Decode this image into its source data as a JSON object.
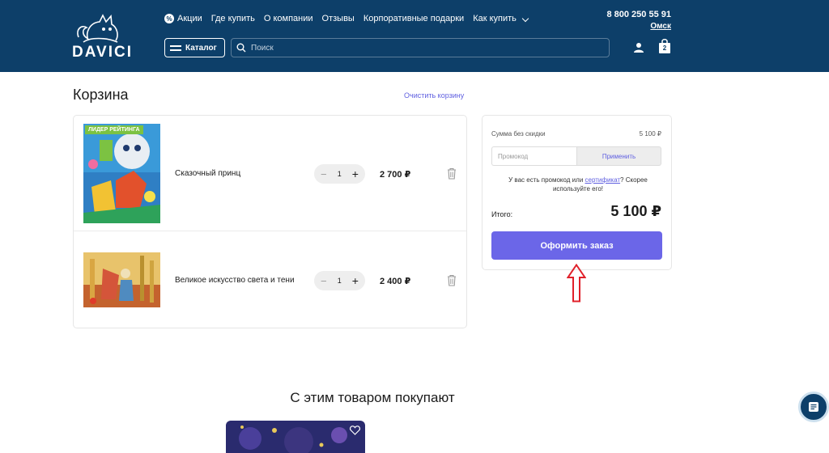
{
  "header": {
    "logo_text": "DAVICI",
    "nav": [
      {
        "label": "Акции"
      },
      {
        "label": "Где купить"
      },
      {
        "label": "О компании"
      },
      {
        "label": "Отзывы"
      },
      {
        "label": "Корпоративные подарки"
      },
      {
        "label": "Как купить"
      }
    ],
    "phone": "8 800 250 55 91",
    "city": "Омск",
    "catalog_label": "Каталог",
    "search_placeholder": "Поиск",
    "cart_count": "2"
  },
  "page": {
    "title": "Корзина",
    "clear_label": "Очистить корзину"
  },
  "cart": {
    "items": [
      {
        "badge": "ЛИДЕР РЕЙТИНГА",
        "name": "Сказочный принц",
        "qty": "1",
        "price": "2 700 ₽"
      },
      {
        "badge": "",
        "name": "Великое искусство света и тени",
        "qty": "1",
        "price": "2 400 ₽"
      }
    ],
    "minus": "−",
    "plus": "+"
  },
  "summary": {
    "subtotal_label": "Сумма без скидки",
    "subtotal_value": "5 100 ₽",
    "promo_placeholder": "Промокод",
    "apply_label": "Применить",
    "hint_before": "У вас есть промокод или ",
    "hint_link": "сертификат",
    "hint_after": "? Скорее используйте его!",
    "total_label": "Итого:",
    "total_value": "5 100 ₽",
    "checkout_label": "Оформить заказ"
  },
  "recommend": {
    "title": "С этим товаром покупают"
  },
  "colors": {
    "header_bg": "#0d3f69",
    "accent": "#6b66e8",
    "link": "#5f5fe0",
    "badge": "#7cc242",
    "arrow": "#e0202a"
  }
}
